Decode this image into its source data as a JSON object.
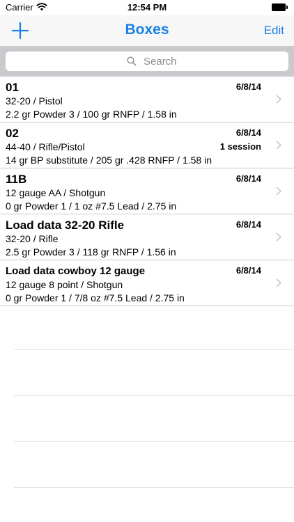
{
  "status_bar": {
    "carrier": "Carrier",
    "time": "12:54 PM"
  },
  "nav": {
    "title": "Boxes",
    "edit_label": "Edit"
  },
  "search": {
    "placeholder": "Search"
  },
  "rows": [
    {
      "title": "01",
      "date": "6/8/14",
      "badge": "",
      "line1": "32-20 / Pistol",
      "line2": "2.2 gr Powder 3 / 100 gr RNFP / 1.58 in"
    },
    {
      "title": "02",
      "date": "6/8/14",
      "badge": "1 session",
      "line1": "44-40 / Rifle/Pistol",
      "line2": "14 gr BP substitute / 205 gr .428 RNFP / 1.58 in"
    },
    {
      "title": "11B",
      "date": "6/8/14",
      "badge": "",
      "line1": "12 gauge AA / Shotgun",
      "line2": "0 gr Powder 1 / 1 oz  #7.5 Lead / 2.75 in"
    },
    {
      "title": "Load data 32-20 Rifle",
      "date": "6/8/14",
      "badge": "",
      "line1": "32-20 / Rifle",
      "line2": "2.5 gr Powder 3 / 118 gr RNFP / 1.56 in"
    },
    {
      "title": "Load data cowboy 12 gauge",
      "date": "6/8/14",
      "badge": "",
      "line1": "12 gauge 8 point / Shotgun",
      "line2": "0 gr Powder 1 / 7/8 oz  #7.5 Lead / 2.75 in"
    }
  ],
  "colors": {
    "accent": "#1a80e6",
    "separator": "#c8c7cc",
    "search_bg": "#c9c9ce"
  },
  "icons": {
    "add": "plus-icon",
    "search": "search-icon",
    "disclosure": "chevron-right-icon",
    "wifi": "wifi-icon",
    "battery": "battery-icon"
  }
}
